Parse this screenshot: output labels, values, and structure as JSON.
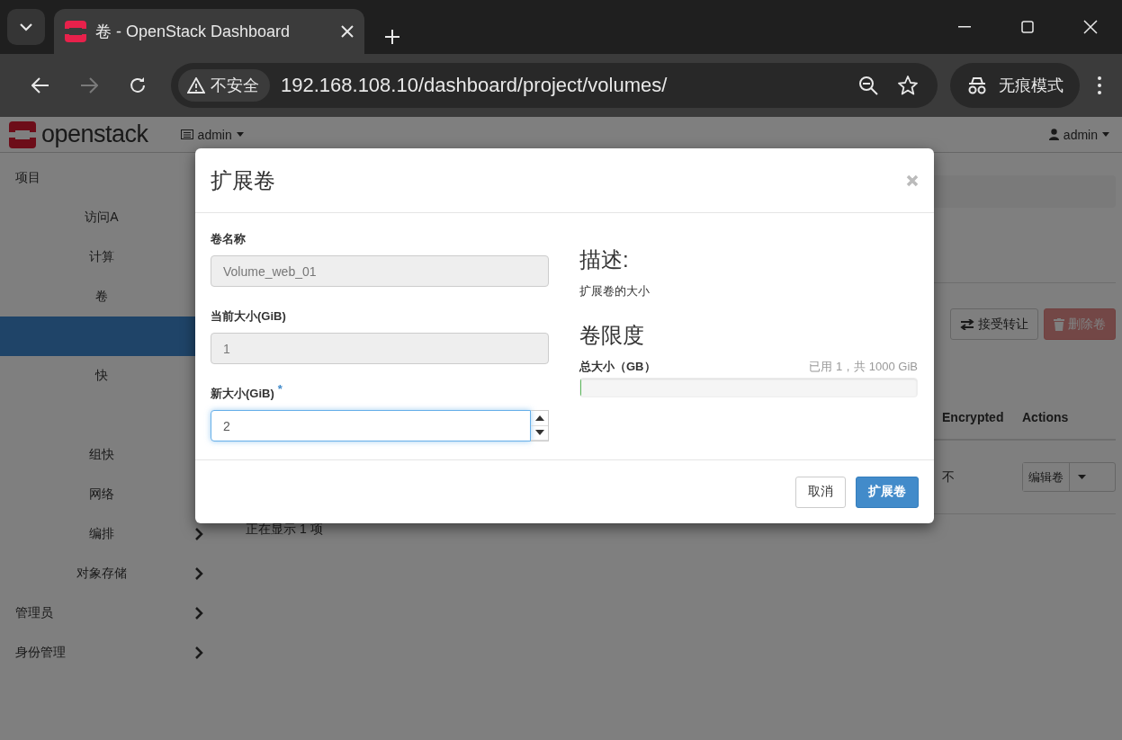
{
  "browser": {
    "tab_title": "卷 - OpenStack Dashboard",
    "security_label": "不安全",
    "url": "192.168.108.10/dashboard/project/volumes/",
    "incognito_label": "无痕模式"
  },
  "header": {
    "logo_text": "openstack",
    "project": "admin",
    "user": "admin"
  },
  "sidebar": {
    "items": [
      {
        "label": "项目",
        "selected": false,
        "children": [
          {
            "label": "访问A",
            "selected": false
          },
          {
            "label": "计算",
            "selected": false
          },
          {
            "label": "卷",
            "selected": false,
            "children": [
              {
                "selected": true
              },
              {
                "label": "快",
                "selected": false
              },
              {
                "selected": false
              },
              {
                "label": "组快",
                "selected": false
              }
            ]
          },
          {
            "label": "网络",
            "selected": false
          },
          {
            "label": "编排",
            "selected": false,
            "arrow": true
          },
          {
            "label": "对象存储",
            "selected": false,
            "arrow": true
          }
        ]
      },
      {
        "label": "管理员",
        "selected": false,
        "arrow": true
      },
      {
        "label": "身份管理",
        "selected": false,
        "arrow": true
      }
    ]
  },
  "toolbar": {
    "buttons": [
      {
        "label": "接受转让",
        "kind": "transfer",
        "disabled": false
      },
      {
        "label": "删除卷",
        "kind": "delete",
        "disabled": true
      }
    ]
  },
  "table": {
    "columns": [
      "Encrypted",
      "Actions"
    ],
    "rows": [
      {
        "encrypted": "不",
        "action": "编辑卷"
      }
    ],
    "footer": "正在显示 1 项"
  },
  "modal": {
    "title": "扩展卷",
    "fields": [
      {
        "label": "卷名称",
        "value": "Volume_web_01",
        "kind": "text",
        "disabled": true
      },
      {
        "label": "当前大小(GiB)",
        "value": "1",
        "kind": "text",
        "disabled": true
      },
      {
        "label": "新大小(GiB)",
        "value": "2",
        "kind": "number",
        "disabled": false,
        "required_mark": "*"
      }
    ],
    "description_heading": "描述:",
    "description": "扩展卷的大小",
    "limits_heading": "卷限度",
    "quota": {
      "label": "总大小（GB）",
      "usage": "已用 1，共 1000 GiB",
      "level": 0.001
    },
    "buttons": [
      {
        "label": "取消",
        "kind": "default"
      },
      {
        "label": "扩展卷",
        "kind": "primary"
      }
    ]
  }
}
